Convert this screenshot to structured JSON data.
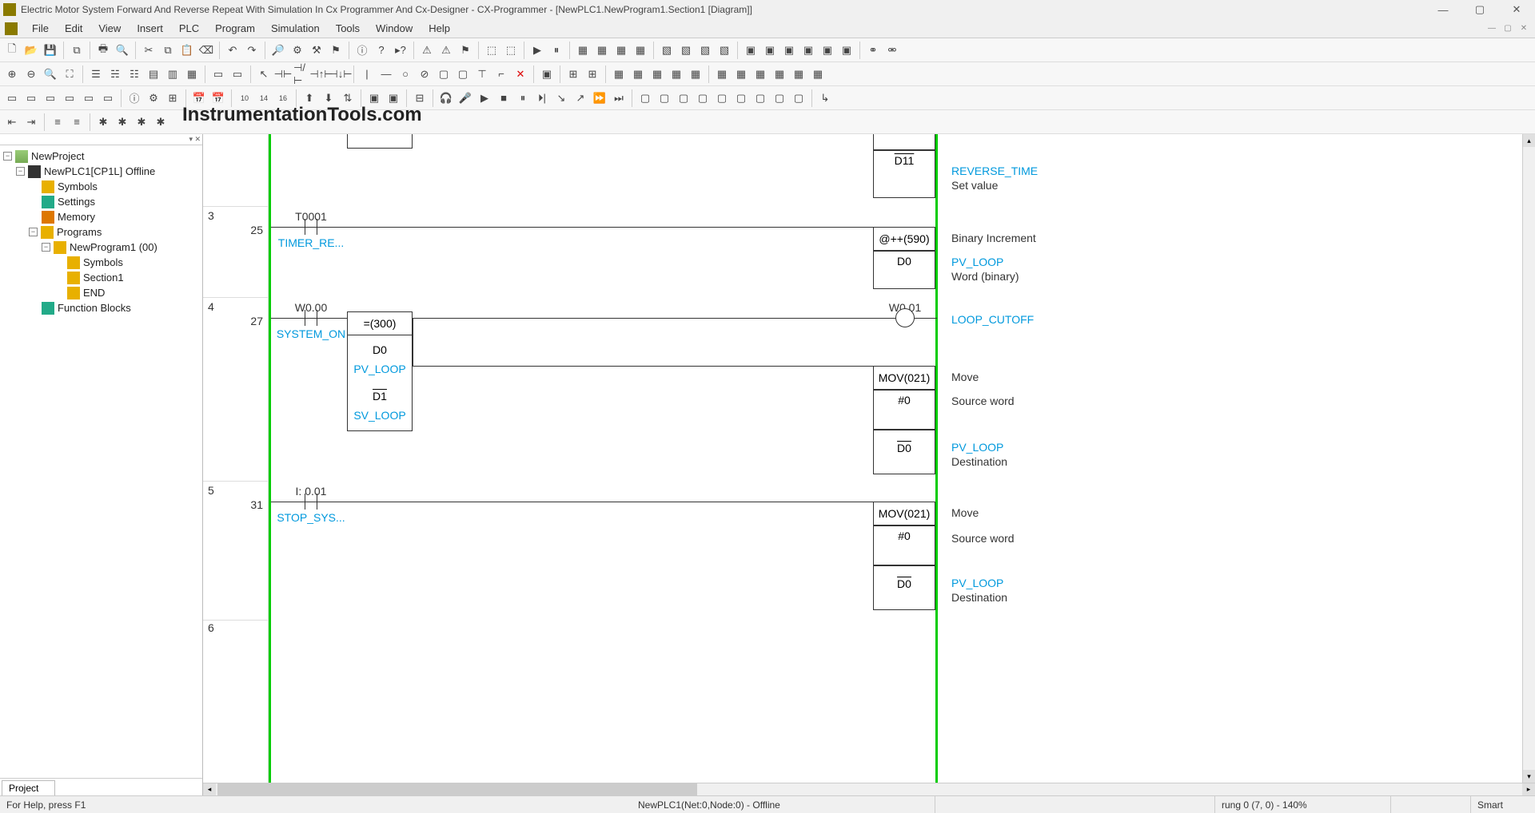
{
  "title": "Electric Motor System Forward And Reverse Repeat With Simulation In Cx Programmer And Cx-Designer - CX-Programmer - [NewPLC1.NewProgram1.Section1 [Diagram]]",
  "menus": [
    "File",
    "Edit",
    "View",
    "Insert",
    "PLC",
    "Program",
    "Simulation",
    "Tools",
    "Window",
    "Help"
  ],
  "watermark": "InstrumentationTools.com",
  "tree": {
    "root": "NewProject",
    "plc": "NewPLC1[CP1L] Offline",
    "symbols": "Symbols",
    "settings": "Settings",
    "memory": "Memory",
    "programs": "Programs",
    "program1": "NewProgram1 (00)",
    "p_symbols": "Symbols",
    "section1": "Section1",
    "end": "END",
    "fblocks": "Function Blocks"
  },
  "projectTab": "Project",
  "rungs": {
    "r2": {
      "box_d11": "D11",
      "cmt_sym": "REVERSE_TIME",
      "cmt": "Set value"
    },
    "r3": {
      "num": "3",
      "addr": "25",
      "contact_addr": "T0001",
      "contact_sym": "TIMER_RE...",
      "box_hdr": "@++(590)",
      "box_val": "D0",
      "cmt1": "Binary Increment",
      "cmt2_sym": "PV_LOOP",
      "cmt2": "Word (binary)"
    },
    "r4": {
      "num": "4",
      "addr": "27",
      "c1_addr": "W0.00",
      "c1_sym": "SYSTEM_ON",
      "cmp_hdr": "=(300)",
      "cmp_r1a": "D0",
      "cmp_r1s": "PV_LOOP",
      "cmp_r2a": "D1",
      "cmp_r2s": "SV_LOOP",
      "coil_addr": "W0.01",
      "coil_sym": "LOOP_CUTOFF",
      "mov_hdr": "MOV(021)",
      "mov_src": "#0",
      "mov_dst": "D0",
      "cmt_mov": "Move",
      "cmt_src": "Source word",
      "cmt_dst_sym": "PV_LOOP",
      "cmt_dst": "Destination"
    },
    "r5": {
      "num": "5",
      "addr": "31",
      "c_addr": "I: 0.01",
      "c_sym": "STOP_SYS...",
      "mov_hdr": "MOV(021)",
      "mov_src": "#0",
      "mov_dst": "D0",
      "cmt_mov": "Move",
      "cmt_src": "Source word",
      "cmt_dst_sym": "PV_LOOP",
      "cmt_dst": "Destination"
    },
    "r6": {
      "num": "6"
    }
  },
  "status": {
    "help": "For Help, press F1",
    "plc": "NewPLC1(Net:0,Node:0) - Offline",
    "rung": "rung 0 (7, 0)  - 140%",
    "smart": "Smart"
  }
}
